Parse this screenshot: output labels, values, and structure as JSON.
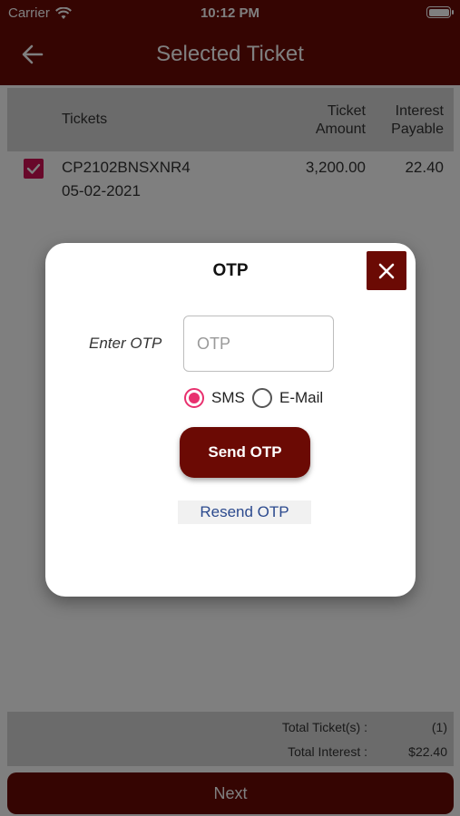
{
  "status": {
    "carrier": "Carrier",
    "time": "10:12 PM"
  },
  "nav": {
    "title": "Selected Ticket"
  },
  "table": {
    "headers": {
      "tickets": "Tickets",
      "amount_line1": "Ticket",
      "amount_line2": "Amount",
      "interest_line1": "Interest",
      "interest_line2": "Payable"
    },
    "rows": [
      {
        "ticket_id": "CP2102BNSXNR4",
        "date": "05-02-2021",
        "amount": "3,200.00",
        "interest": "22.40",
        "checked": true
      }
    ]
  },
  "summary": {
    "total_tickets_label": "Total Ticket(s) :",
    "total_tickets_value": "(1)",
    "total_interest_label": "Total Interest :",
    "total_interest_value": "$22.40"
  },
  "next_label": "Next",
  "modal": {
    "title": "OTP",
    "otp_label": "Enter OTP",
    "otp_placeholder": "OTP",
    "otp_value": "",
    "options": [
      {
        "label": "SMS",
        "selected": true
      },
      {
        "label": "E-Mail",
        "selected": false
      }
    ],
    "send_label": "Send OTP",
    "resend_label": "Resend OTP"
  },
  "colors": {
    "primary": "#6b0a04",
    "accent": "#e8306e",
    "link": "#2c4a8e"
  }
}
